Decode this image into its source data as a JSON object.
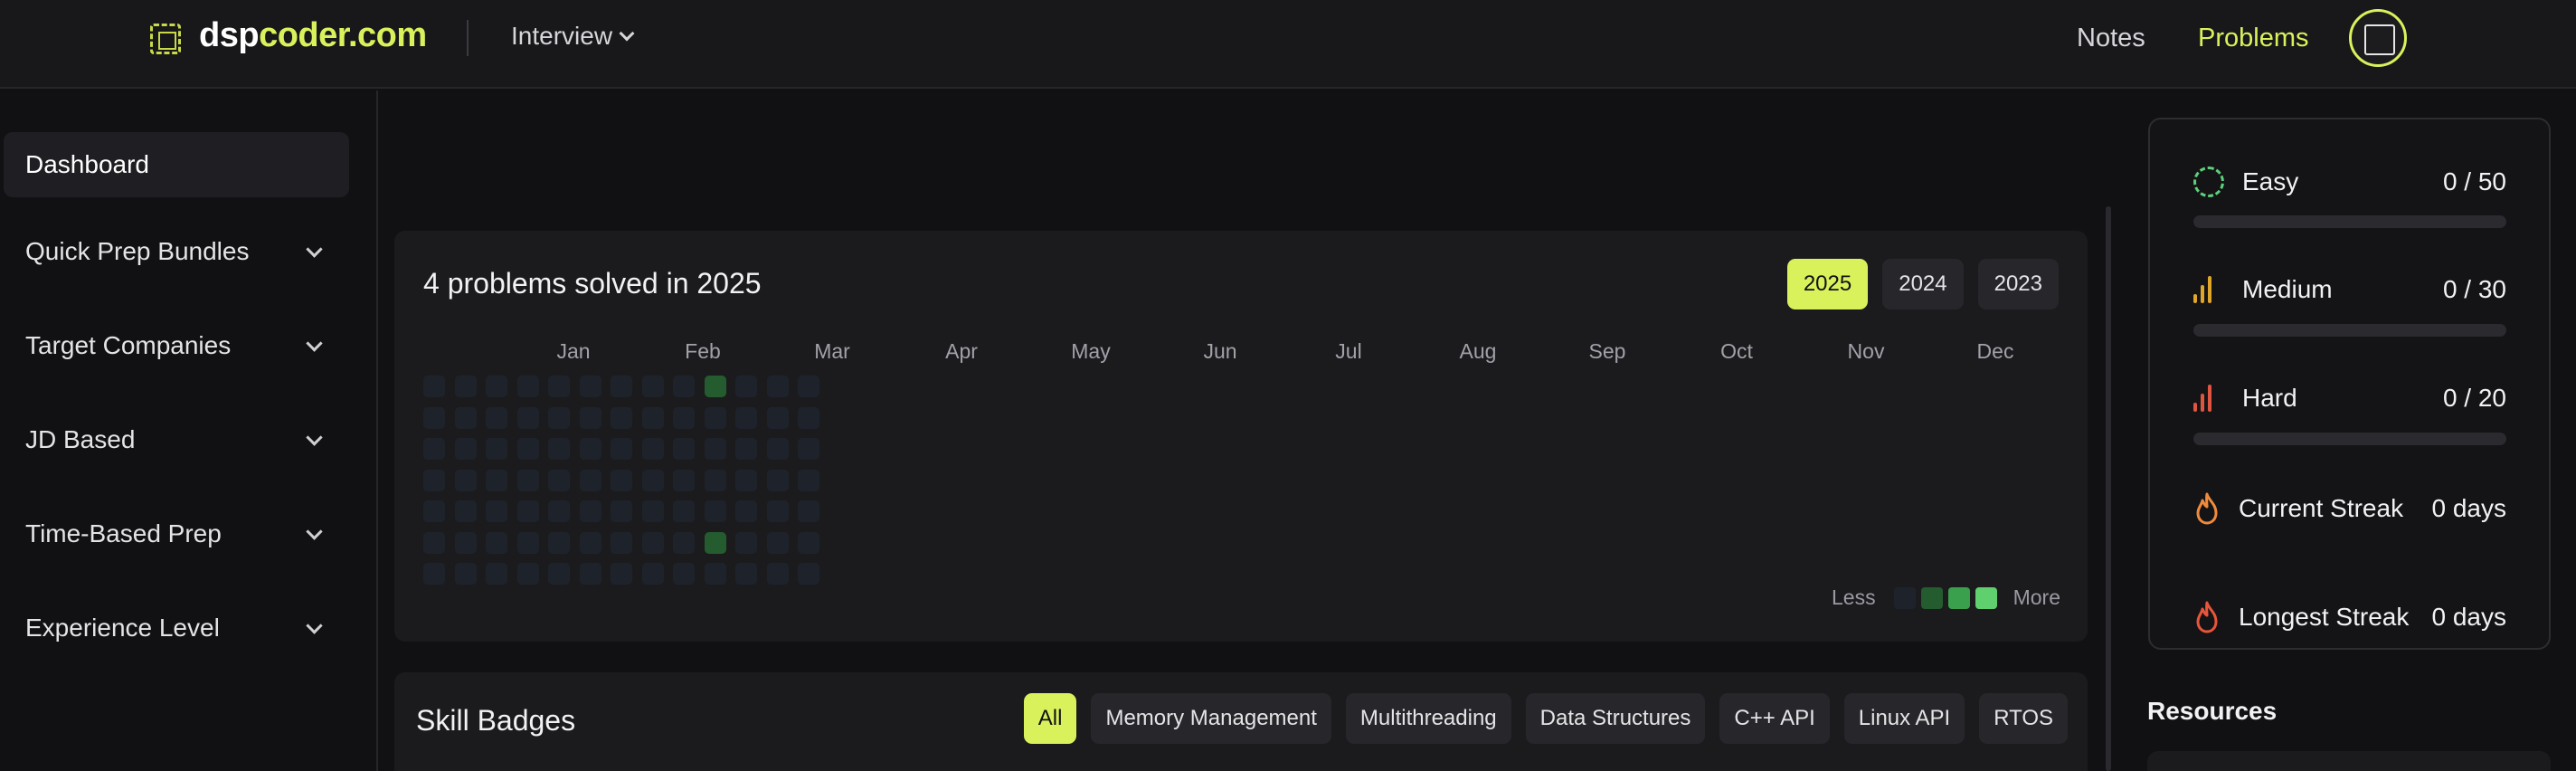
{
  "header": {
    "logo_a": "dsp",
    "logo_b": "coder.com",
    "interview_label": "Interview",
    "nav": {
      "notes": "Notes",
      "problems": "Problems"
    }
  },
  "sidebar": {
    "items": [
      {
        "label": "Dashboard",
        "expandable": false
      },
      {
        "label": "Quick Prep Bundles",
        "expandable": true
      },
      {
        "label": "Target Companies",
        "expandable": true
      },
      {
        "label": "JD Based",
        "expandable": true
      },
      {
        "label": "Time-Based Prep",
        "expandable": true
      },
      {
        "label": "Experience Level",
        "expandable": true
      }
    ]
  },
  "heatmap": {
    "title": "4 problems solved in 2025",
    "years": [
      "2025",
      "2024",
      "2023"
    ],
    "selected_year": "2025",
    "months": [
      "Jan",
      "Feb",
      "Mar",
      "Apr",
      "May",
      "Jun",
      "Jul",
      "Aug",
      "Sep",
      "Oct",
      "Nov",
      "Dec"
    ],
    "weeks_shown": 13,
    "active_days": [
      {
        "week": 9,
        "day": 0
      },
      {
        "week": 9,
        "day": 5
      }
    ],
    "legend": {
      "less": "Less",
      "more": "More",
      "colors": [
        "#1e232b",
        "#245c2f",
        "#3aa04e",
        "#5fd06d"
      ]
    }
  },
  "skills": {
    "title": "Skill Badges",
    "filters": [
      "All",
      "Memory Management",
      "Multithreading",
      "Data Structures",
      "C++ API",
      "Linux API",
      "RTOS"
    ],
    "selected": "All"
  },
  "stats": {
    "difficulty": [
      {
        "label": "Easy",
        "value": "0 / 50",
        "progress": 0,
        "color": "#5ecf7a",
        "icon": "dashed-circle-icon"
      },
      {
        "label": "Medium",
        "value": "0 / 30",
        "progress": 0,
        "color": "#e0a62a",
        "icon": "signal-bars-icon"
      },
      {
        "label": "Hard",
        "value": "0 / 20",
        "progress": 0,
        "color": "#e0553f",
        "icon": "signal-bars-icon"
      }
    ],
    "streaks": [
      {
        "label": "Current Streak",
        "value": "0 days",
        "color": "#f08a3c",
        "icon": "flame-icon"
      },
      {
        "label": "Longest Streak",
        "value": "0 days",
        "color": "#e8553a",
        "icon": "flame-icon"
      }
    ]
  },
  "resources": {
    "title": "Resources"
  },
  "colors": {
    "accent": "#d9f25c",
    "background": "#111113",
    "panel": "#1b1b1e"
  }
}
